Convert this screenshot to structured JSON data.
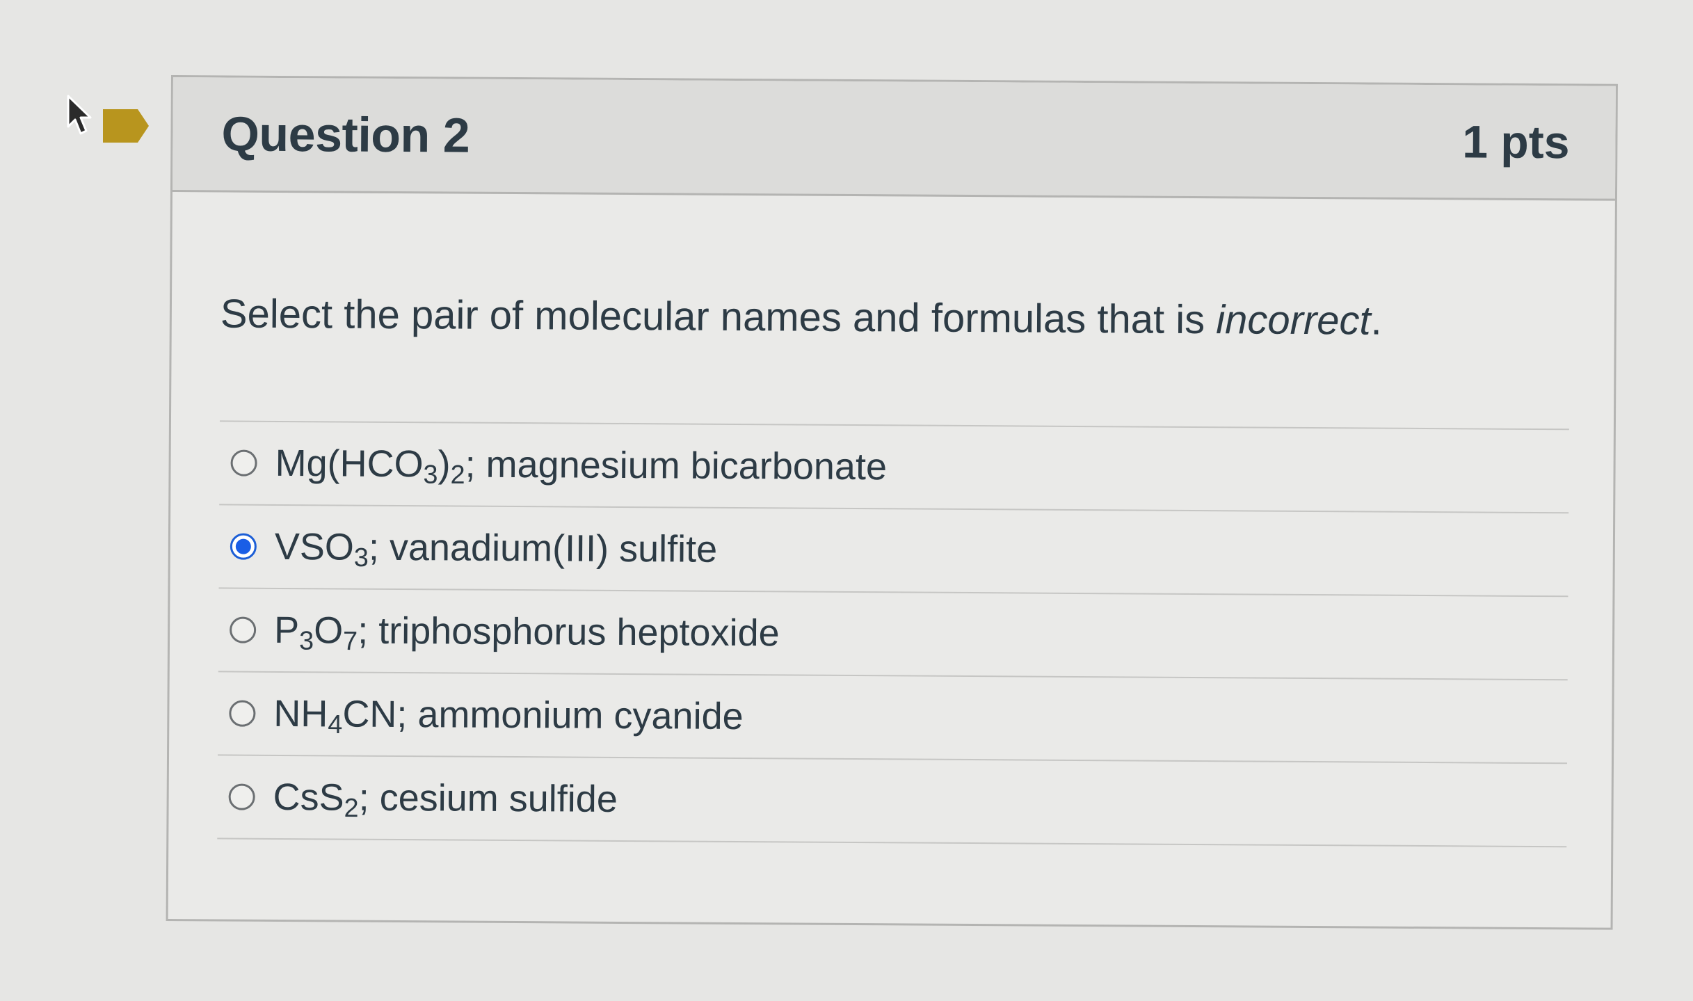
{
  "question": {
    "title": "Question 2",
    "points": "1 pts",
    "prompt": {
      "text": "Select the pair of molecular names and formulas that is ",
      "emphasis": "incorrect",
      "end": "."
    }
  },
  "answers": [
    {
      "parts": [
        {
          "t": "Mg(HCO"
        },
        {
          "t": "3",
          "sub": true
        },
        {
          "t": ")"
        },
        {
          "t": "2",
          "sub": true
        },
        {
          "t": "; magnesium bicarbonate"
        }
      ],
      "selected": false
    },
    {
      "parts": [
        {
          "t": "VSO"
        },
        {
          "t": "3",
          "sub": true
        },
        {
          "t": "; vanadium(III) sulfite"
        }
      ],
      "selected": true
    },
    {
      "parts": [
        {
          "t": "P"
        },
        {
          "t": "3",
          "sub": true
        },
        {
          "t": "O"
        },
        {
          "t": "7",
          "sub": true
        },
        {
          "t": "; triphosphorus heptoxide"
        }
      ],
      "selected": false
    },
    {
      "parts": [
        {
          "t": "NH"
        },
        {
          "t": "4",
          "sub": true
        },
        {
          "t": "CN; ammonium cyanide"
        }
      ],
      "selected": false
    },
    {
      "parts": [
        {
          "t": "CsS"
        },
        {
          "t": "2",
          "sub": true
        },
        {
          "t": "; cesium sulfide"
        }
      ],
      "selected": false
    }
  ],
  "colors": {
    "flag": "#b8951e",
    "radio_selected": "#1a5ee6",
    "text": "#2d3b45"
  },
  "icons": {
    "cursor": "mouse-pointer-icon",
    "flag": "bookmark-flag-icon"
  }
}
